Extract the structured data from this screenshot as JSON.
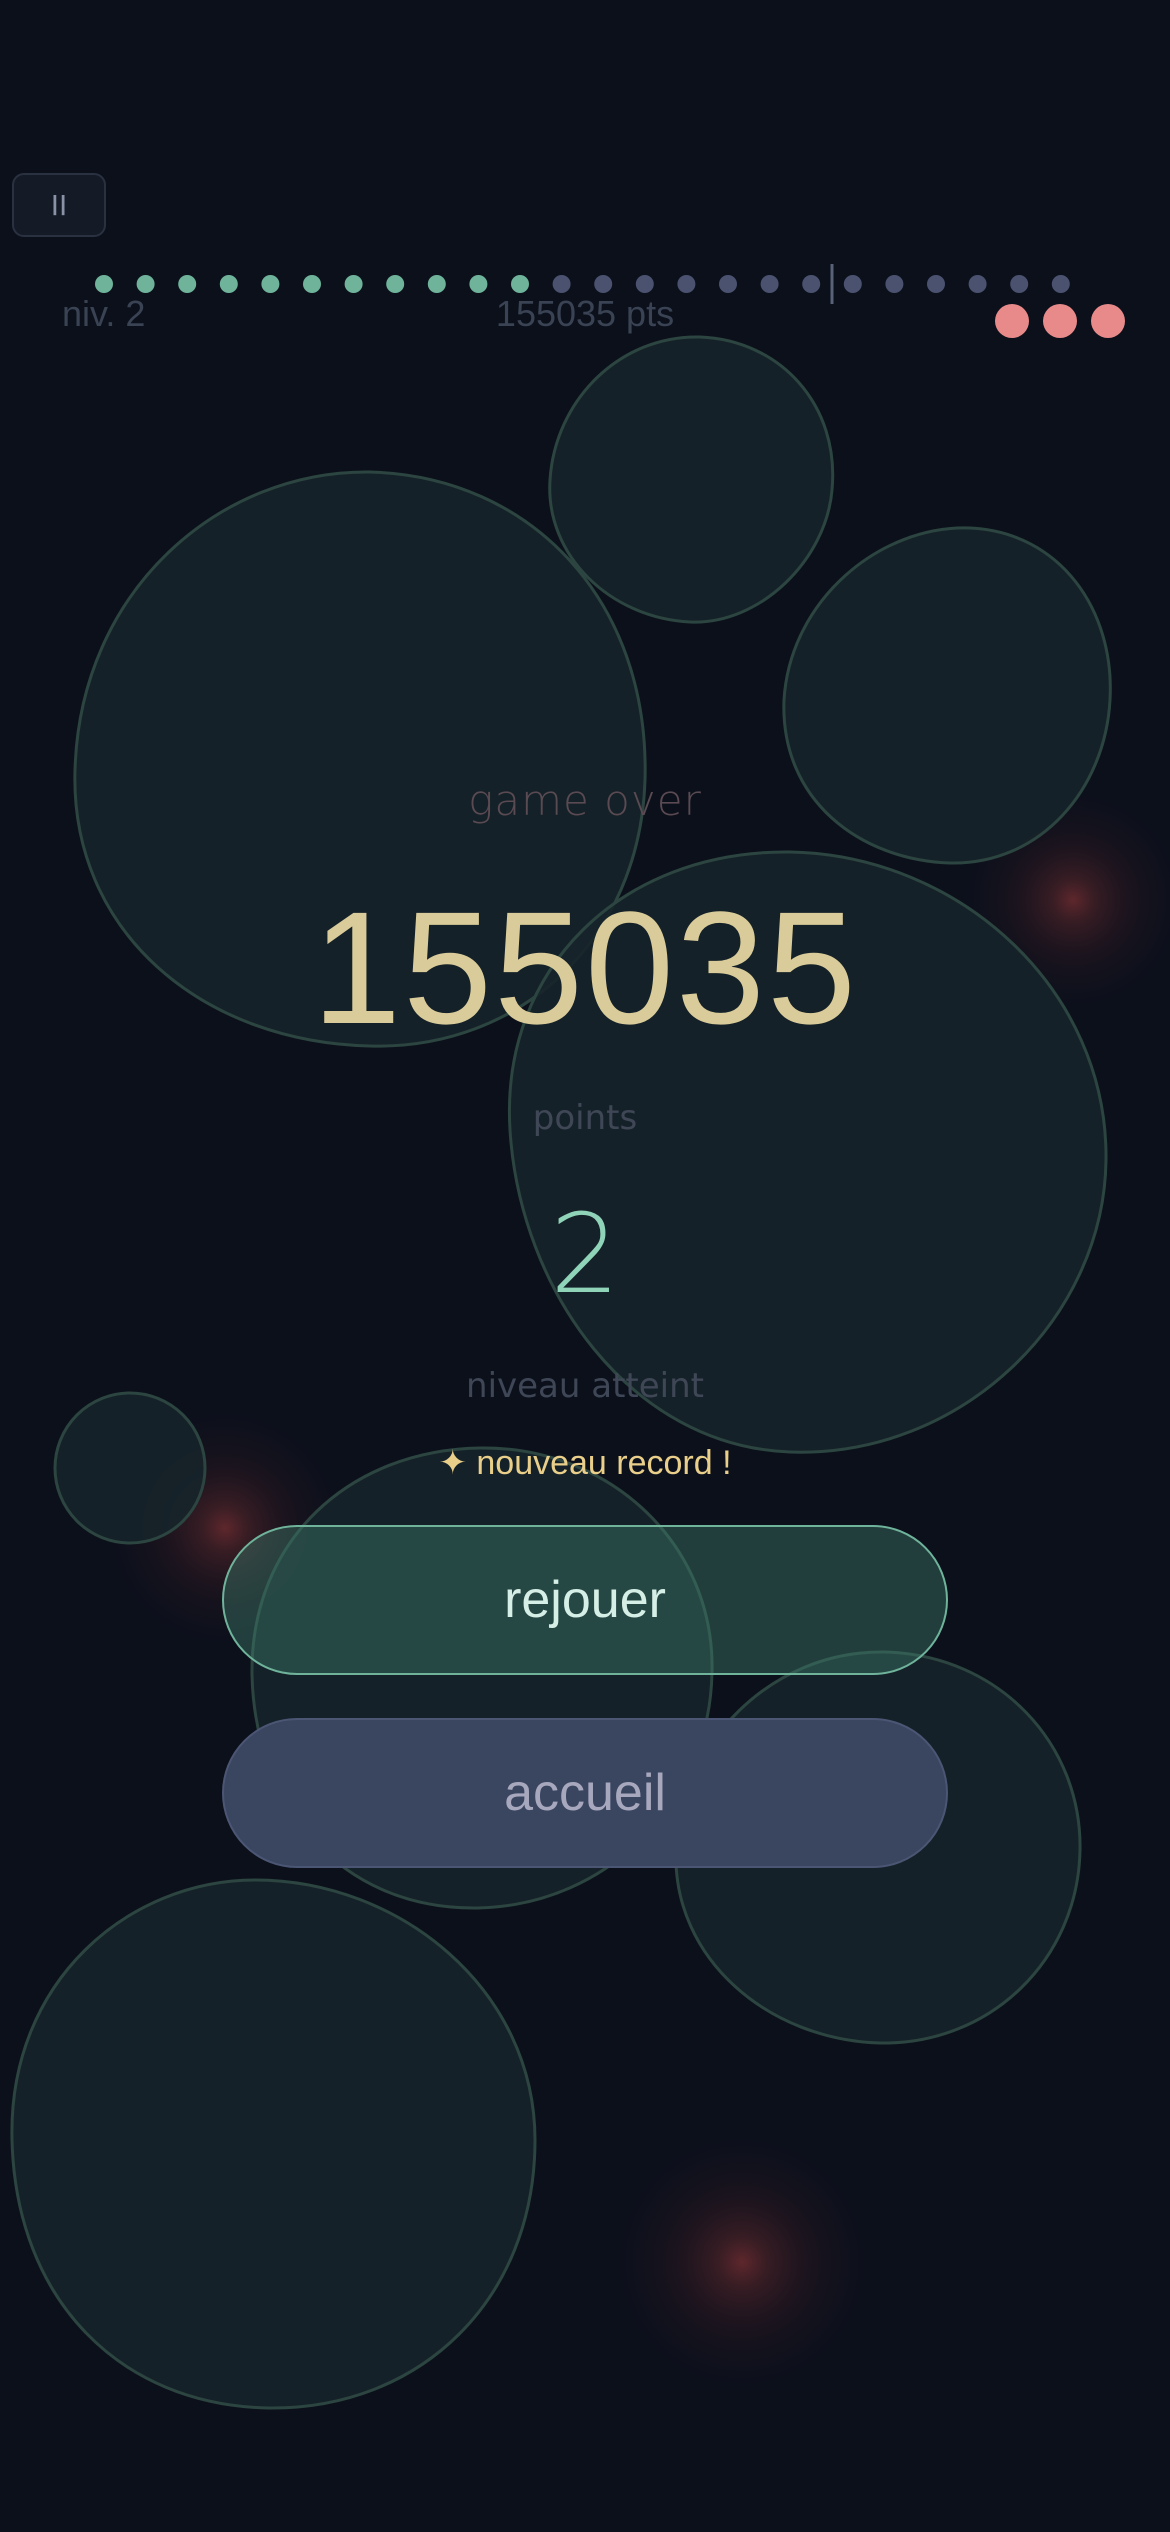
{
  "hud": {
    "pause_label": "II",
    "level_text": "niv. 2",
    "score_text": "155035 pts",
    "lives_remaining": 3,
    "progress": {
      "total_dots": 24,
      "completed_dots": 11,
      "marker_after_dot": 18
    }
  },
  "result": {
    "gameover_label": "game over",
    "final_score": "155035",
    "points_label": "points",
    "level_value": "2",
    "level_label": "niveau atteint",
    "record_badge": "✦ nouveau record !"
  },
  "buttons": {
    "replay_label": "rejouer",
    "home_label": "accueil"
  },
  "colors": {
    "background": "#0b101b",
    "bubble_fill": "#16232a",
    "bubble_stroke": "#2c4540",
    "dot_done": "#6fb39b",
    "dot_pending": "#4a5270",
    "life": "#e88a8a",
    "score": "#d9cc9a",
    "record": "#e9cf8a",
    "hazard": "#a23b3b"
  }
}
